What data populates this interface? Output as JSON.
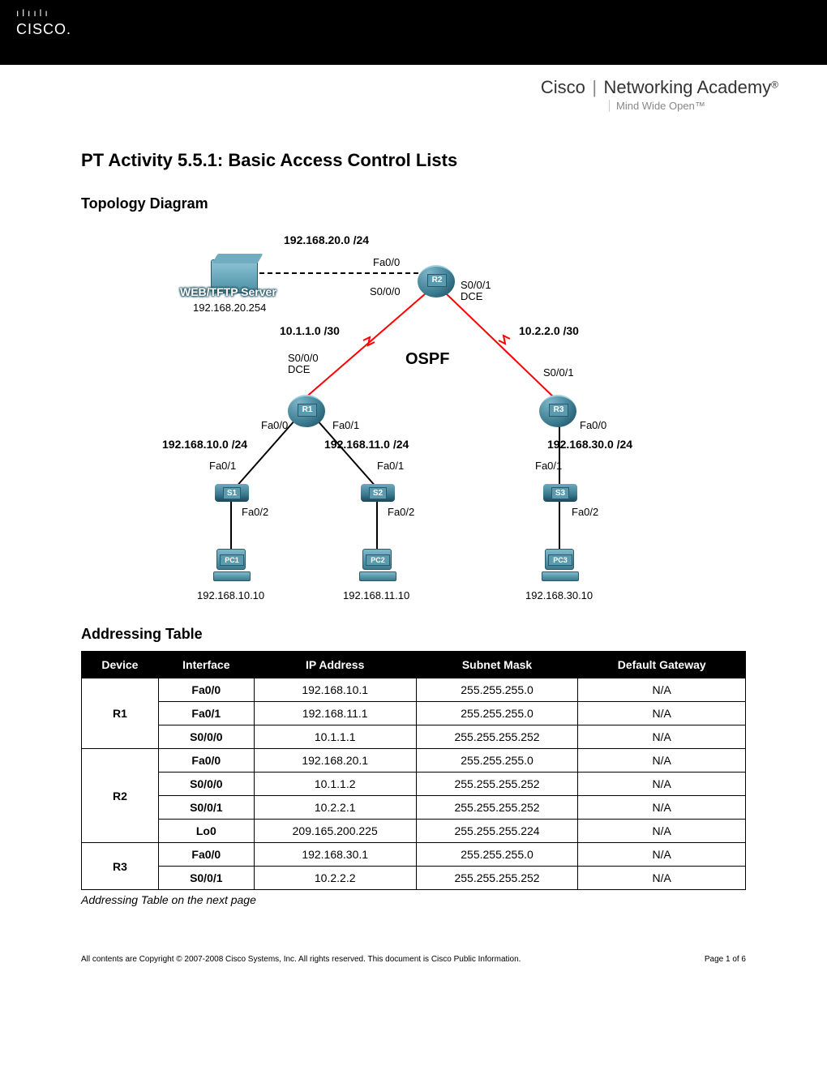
{
  "header": {
    "logo_bars": "ılıılı",
    "logo_text": "CISCO.",
    "academy_left": "Cisco",
    "academy_right": "Networking Academy",
    "academy_reg": "®",
    "tagline": "Mind Wide Open™"
  },
  "title": "PT Activity 5.5.1: Basic Access Control Lists",
  "sections": {
    "topology": "Topology Diagram",
    "addressing": "Addressing Table"
  },
  "diagram": {
    "net_192_168_20": "192.168.20.0 /24",
    "server_label": "WEB/TFTP Server",
    "server_ip": "192.168.20.254",
    "r2_fa00": "Fa0/0",
    "r2_s000": "S0/0/0",
    "r2_s001": "S0/0/1",
    "r2_dce": "DCE",
    "r2": "R2",
    "net_10_1_1": "10.1.1.0 /30",
    "net_10_2_2": "10.2.2.0 /30",
    "ospf": "OSPF",
    "r1_s000": "S0/0/0",
    "r1_dce": "DCE",
    "r3_s001": "S0/0/1",
    "r1": "R1",
    "r3": "R3",
    "r1_fa00": "Fa0/0",
    "r1_fa01": "Fa0/1",
    "r3_fa00": "Fa0/0",
    "net_192_168_10": "192.168.10.0 /24",
    "net_192_168_11": "192.168.11.0 /24",
    "net_192_168_30": "192.168.30.0 /24",
    "s1_fa01": "Fa0/1",
    "s2_fa01": "Fa0/1",
    "s3_fa01": "Fa0/1",
    "s1": "S1",
    "s2": "S2",
    "s3": "S3",
    "s1_fa02": "Fa0/2",
    "s2_fa02": "Fa0/2",
    "s3_fa02": "Fa0/2",
    "pc1": "PC1",
    "pc2": "PC2",
    "pc3": "PC3",
    "pc1_ip": "192.168.10.10",
    "pc2_ip": "192.168.11.10",
    "pc3_ip": "192.168.30.10"
  },
  "table": {
    "headers": [
      "Device",
      "Interface",
      "IP Address",
      "Subnet Mask",
      "Default Gateway"
    ],
    "groups": [
      {
        "device": "R1",
        "rows": [
          [
            "Fa0/0",
            "192.168.10.1",
            "255.255.255.0",
            "N/A"
          ],
          [
            "Fa0/1",
            "192.168.11.1",
            "255.255.255.0",
            "N/A"
          ],
          [
            "S0/0/0",
            "10.1.1.1",
            "255.255.255.252",
            "N/A"
          ]
        ]
      },
      {
        "device": "R2",
        "rows": [
          [
            "Fa0/0",
            "192.168.20.1",
            "255.255.255.0",
            "N/A"
          ],
          [
            "S0/0/0",
            "10.1.1.2",
            "255.255.255.252",
            "N/A"
          ],
          [
            "S0/0/1",
            "10.2.2.1",
            "255.255.255.252",
            "N/A"
          ],
          [
            "Lo0",
            "209.165.200.225",
            "255.255.255.224",
            "N/A"
          ]
        ]
      },
      {
        "device": "R3",
        "rows": [
          [
            "Fa0/0",
            "192.168.30.1",
            "255.255.255.0",
            "N/A"
          ],
          [
            "S0/0/1",
            "10.2.2.2",
            "255.255.255.252",
            "N/A"
          ]
        ]
      }
    ],
    "note": "Addressing Table on the next page"
  },
  "footer": {
    "copyright": "All contents are Copyright © 2007-2008 Cisco Systems, Inc. All rights reserved. This document is Cisco Public Information.",
    "page": "Page 1 of 6"
  }
}
